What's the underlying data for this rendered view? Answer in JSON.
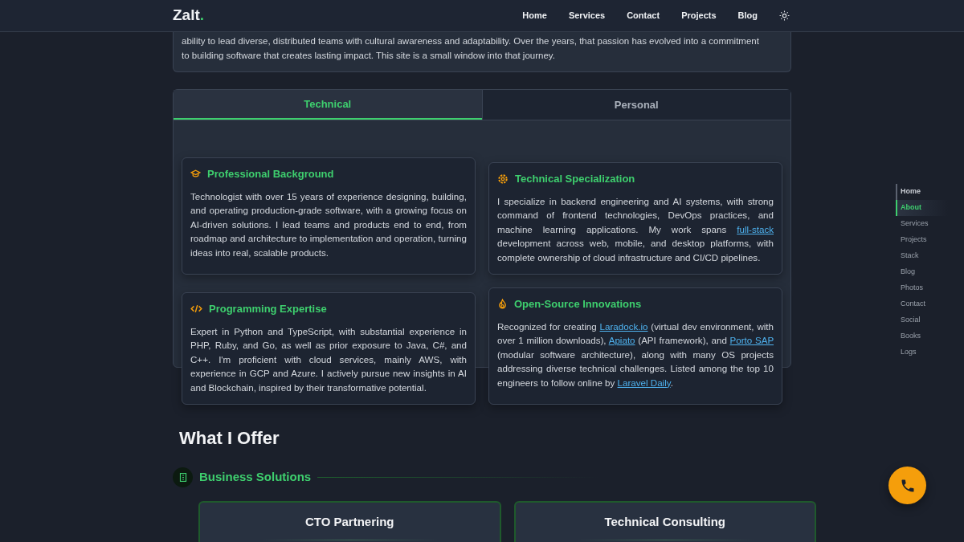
{
  "header": {
    "logo": "Zalt",
    "logo_dot": ".",
    "nav": [
      "Home",
      "Services",
      "Contact",
      "Projects",
      "Blog"
    ]
  },
  "intro": {
    "lines": [
      "ability to lead diverse, distributed teams with cultural awareness and adaptability. Over the years, that passion has evolved into a commitment",
      "to building software that creates lasting impact. This site is a small window into that journey."
    ]
  },
  "tabs": [
    {
      "label": "Technical",
      "selected": true
    },
    {
      "label": "Personal",
      "selected": false
    }
  ],
  "cards": [
    {
      "kind": "cap",
      "title": "Professional Background",
      "body": [
        {
          "kind": "text",
          "text": "Technologist with over 15 years of experience designing, building, and operating production-grade software, with a growing focus on AI-driven solutions. I lead teams and products end to end, from roadmap and architecture to implementation and operation, turning ideas into real, scalable products."
        }
      ]
    },
    {
      "kind": "gear",
      "title": "Technical Specialization",
      "body": [
        {
          "kind": "text",
          "text": "I specialize in backend engineering and AI systems, with strong command of frontend technologies, DevOps practices, and machine learning applications. My work spans "
        },
        {
          "kind": "link",
          "text": "full-stack"
        },
        {
          "kind": "text",
          "text": " development across web, mobile, and desktop platforms, with complete ownership of cloud infrastructure and CI/CD pipelines."
        }
      ]
    },
    {
      "kind": "code",
      "title": "Programming Expertise",
      "body": [
        {
          "kind": "text",
          "text": "Expert in Python and TypeScript, with substantial experience in PHP, Ruby, and Go, as well as prior exposure to Java, C#, and C++. I'm proficient with cloud services, mainly AWS, with experience in GCP and Azure. I actively pursue new insights in AI and Blockchain, inspired by their transformative potential."
        }
      ]
    },
    {
      "kind": "flame",
      "title": "Open-Source Innovations",
      "body": [
        {
          "kind": "text",
          "text": "Recognized for creating "
        },
        {
          "kind": "link",
          "text": "Laradock.io"
        },
        {
          "kind": "text",
          "text": " (virtual dev environment, with over 1 million downloads), "
        },
        {
          "kind": "link",
          "text": "Apiato"
        },
        {
          "kind": "text",
          "text": " (API framework), and "
        },
        {
          "kind": "link",
          "text": "Porto SAP"
        },
        {
          "kind": "text",
          "text": " (modular software architecture), along with many OS projects addressing diverse technical challenges. Listed among the top 10 engineers to follow online by "
        },
        {
          "kind": "link",
          "text": "Laravel Daily"
        },
        {
          "kind": "text",
          "text": "."
        }
      ]
    }
  ],
  "offer": {
    "heading": "What I Offer",
    "section": "Business Solutions",
    "cards": [
      "CTO Partnering",
      "Technical Consulting"
    ]
  },
  "side_nav": [
    {
      "label": "Home",
      "selected": false
    },
    {
      "label": "About",
      "selected": true
    },
    {
      "label": "Services",
      "selected": false
    },
    {
      "label": "Projects",
      "selected": false
    },
    {
      "label": "Stack",
      "selected": false
    },
    {
      "label": "Blog",
      "selected": false
    },
    {
      "label": "Photos",
      "selected": false
    },
    {
      "label": "Contact",
      "selected": false
    },
    {
      "label": "Social",
      "selected": false
    },
    {
      "label": "Books",
      "selected": false
    },
    {
      "label": "Logs",
      "selected": false
    }
  ]
}
